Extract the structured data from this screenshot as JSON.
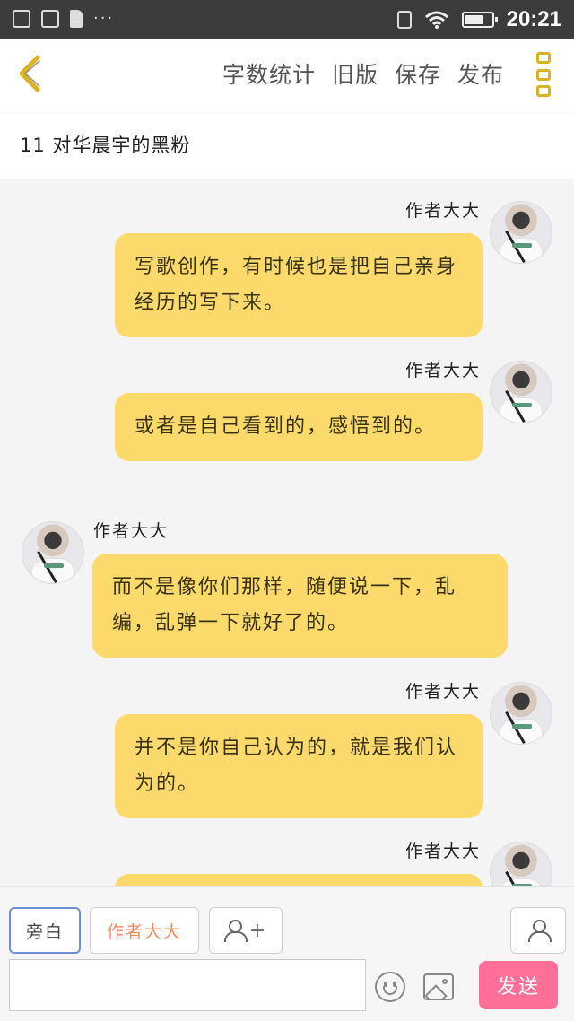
{
  "status_bar": {
    "time": "20:21",
    "dots": "···"
  },
  "toolbar": {
    "word_count": "字数统计",
    "old_version": "旧版",
    "save": "保存",
    "publish": "发布"
  },
  "chapter": {
    "title": "11 对华晨宇的黑粉"
  },
  "messages": [
    {
      "side": "right",
      "name": "作者大大",
      "text": "写歌创作，有时候也是把自己亲身经历的写下来。"
    },
    {
      "side": "right",
      "name": "作者大大",
      "text": "或者是自己看到的，感悟到的。"
    },
    {
      "side": "left",
      "name": "作者大大",
      "text": "而不是像你们那样，随便说一下，乱编，乱弹一下就好了的。"
    },
    {
      "side": "right",
      "name": "作者大大",
      "text": "并不是你自己认为的，就是我们认为的。"
    },
    {
      "side": "right",
      "name": "作者大大",
      "text": ""
    }
  ],
  "input": {
    "narration_chip": "旁白",
    "author_chip": "作者大大",
    "add_role_plus": "+",
    "placeholder": "",
    "send_label": "发送"
  },
  "colors": {
    "bubble": "#fbd96a",
    "send": "#ff6f97",
    "accent": "#d9b324"
  }
}
